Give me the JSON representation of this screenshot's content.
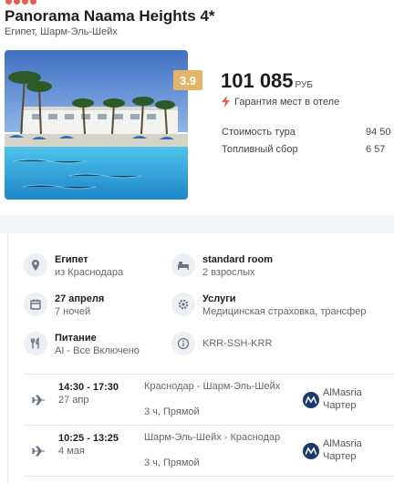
{
  "hotel": {
    "stars": 4,
    "name": "Panorama Naama Heights 4*",
    "location": "Египет, Шарм-Эль-Шейх",
    "rating": "3.9"
  },
  "pricing": {
    "price": "101 085",
    "currency": "РУБ",
    "guarantee": "Гарантия мест в отеле",
    "rows": [
      {
        "label": "Стоимость тура",
        "value": "94 50"
      },
      {
        "label": "Топливный сбор",
        "value": "6 57"
      }
    ]
  },
  "details": {
    "country": {
      "main": "Египет",
      "sub": "из Краснодара"
    },
    "room": {
      "main": "standard room",
      "sub": "2 взрослых"
    },
    "dates": {
      "main": "27 апреля",
      "sub": "7 ночей"
    },
    "services": {
      "main": "Услуги",
      "sub": "Медицинская страховка, трансфер"
    },
    "meals": {
      "main": "Питание",
      "sub": "AI - Все Включено"
    },
    "route_code": "KRR-SSH-KRR"
  },
  "flights": [
    {
      "time": "14:30 - 17:30",
      "date": "27 апр",
      "route": "Краснодар - Шарм-Эль-Шейх",
      "duration": "3 ч, Прямой",
      "airline": "AlMasria",
      "type": "Чартер"
    },
    {
      "time": "10:25 - 13:25",
      "date": "4 мая",
      "route": "Шарм-Эль-Шейх - Краснодар",
      "duration": "3 ч, Прямой",
      "airline": "AlMasria",
      "type": "Чартер"
    }
  ],
  "colors": {
    "stars": "#e2604e",
    "rating_badge": "#e2b56b",
    "bolt": "#e2604e",
    "airline": "#1e3a6b"
  }
}
